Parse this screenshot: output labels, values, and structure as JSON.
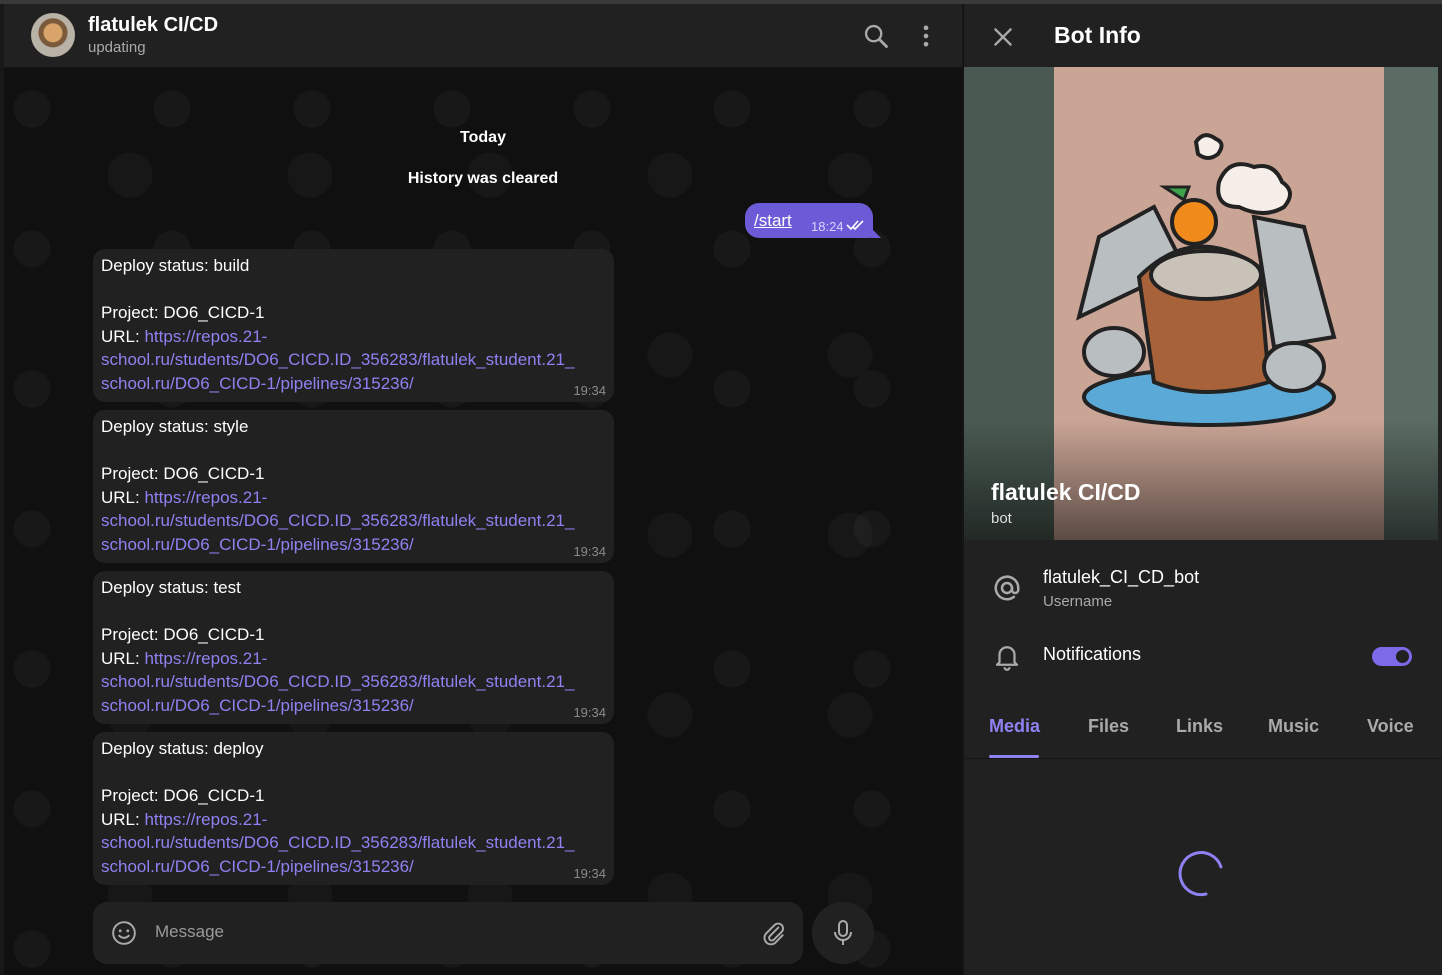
{
  "chat": {
    "title": "flatulek CI/CD",
    "status": "updating",
    "date_label": "Today",
    "service_message": "History was cleared",
    "outgoing": {
      "text": "/start",
      "time": "18:24"
    },
    "messages": [
      {
        "line1": "Deploy status: build",
        "project": "Project: DO6_CICD-1",
        "url_label": "URL: ",
        "url_part1": "https://repos.21-",
        "url_part2": "school.ru/students/DO6_CICD.ID_356283/flatulek_student.21_",
        "url_part3": "school.ru/DO6_CICD-1/pipelines/315236/",
        "time": "19:34"
      },
      {
        "line1": "Deploy status: style",
        "project": "Project: DO6_CICD-1",
        "url_label": "URL: ",
        "url_part1": "https://repos.21-",
        "url_part2": "school.ru/students/DO6_CICD.ID_356283/flatulek_student.21_",
        "url_part3": "school.ru/DO6_CICD-1/pipelines/315236/",
        "time": "19:34"
      },
      {
        "line1": "Deploy status: test",
        "project": "Project: DO6_CICD-1",
        "url_label": "URL: ",
        "url_part1": "https://repos.21-",
        "url_part2": "school.ru/students/DO6_CICD.ID_356283/flatulek_student.21_",
        "url_part3": "school.ru/DO6_CICD-1/pipelines/315236/",
        "time": "19:34"
      },
      {
        "line1": "Deploy status: deploy",
        "project": "Project: DO6_CICD-1",
        "url_label": "URL: ",
        "url_part1": "https://repos.21-",
        "url_part2": "school.ru/students/DO6_CICD.ID_356283/flatulek_student.21_",
        "url_part3": "school.ru/DO6_CICD-1/pipelines/315236/",
        "time": "19:34"
      }
    ],
    "composer_placeholder": "Message"
  },
  "panel": {
    "title": "Bot Info",
    "name": "flatulek CI/CD",
    "subtitle": "bot",
    "username": "flatulek_CI_CD_bot",
    "username_label": "Username",
    "notifications_label": "Notifications",
    "notifications_on": true,
    "tabs": [
      "Media",
      "Files",
      "Links",
      "Music",
      "Voice"
    ],
    "active_tab": "Media"
  },
  "colors": {
    "accent": "#8e82f2",
    "outgoing_bubble": "#6b5bd6",
    "panel_bg": "#212121",
    "chat_bg": "#0f0f0f"
  },
  "icons": [
    "search-icon",
    "more-vertical-icon",
    "double-check-icon",
    "emoji-icon",
    "paperclip-icon",
    "microphone-icon",
    "close-icon",
    "at-sign-icon",
    "bell-icon",
    "loading-spinner-icon"
  ]
}
